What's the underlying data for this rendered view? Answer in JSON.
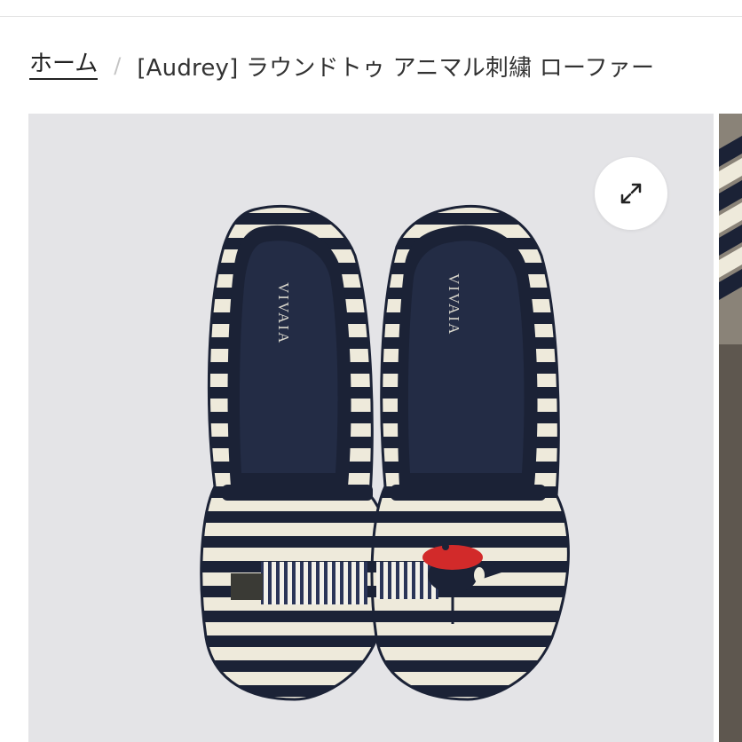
{
  "breadcrumb": {
    "home_label": "ホーム",
    "separator": "/",
    "current_label": "[Audrey] ラウンドトゥ アニマル刺繍 ローファー"
  },
  "gallery": {
    "insole_brand": "VIVAIA",
    "expand_icon": "expand-arrows-icon",
    "colors": {
      "background": "#e4e4e7",
      "navy": "#1b2236",
      "cream": "#eeeadb",
      "beret": "#d22a2a"
    }
  }
}
